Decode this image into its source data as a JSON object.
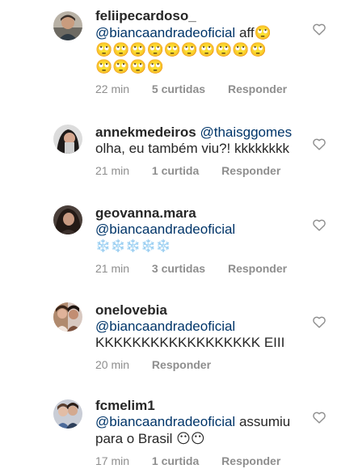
{
  "comments": [
    {
      "username": "feliipecardoso_",
      "mention": "@biancaandradeoficial",
      "text": " aff",
      "emoji_lines": [
        "🙄",
        "🙄🙄🙄🙄🙄🙄🙄🙄🙄🙄",
        "🙄🙄🙄🙄"
      ],
      "time": "22 min",
      "likes": "5 curtidas",
      "reply": "Responder",
      "like_icon": "heart-outline-icon"
    },
    {
      "username": "annekmedeiros",
      "mention": "@thaisggomes",
      "text_line2": "olha, eu também viu?! kkkkkkkk",
      "time": "21 min",
      "likes": "1 curtida",
      "reply": "Responder",
      "like_icon": "heart-outline-icon"
    },
    {
      "username": "geovanna.mara",
      "mention": "@biancaandradeoficial",
      "emoji_line": "❄️❄️❄️❄️❄️",
      "time": "21 min",
      "likes": "3 curtidas",
      "reply": "Responder",
      "like_icon": "heart-outline-icon"
    },
    {
      "username": "onelovebia",
      "mention": "@biancaandradeoficial",
      "text_line2": "KKKKKKKKKKKKKKKKKK EIII",
      "time": "20 min",
      "reply": "Responder",
      "like_icon": "heart-outline-icon"
    },
    {
      "username": "fcmelim1",
      "mention": "@biancaandradeoficial",
      "text": " assumiu",
      "text_line2": "para o Brasil ",
      "emoji": "😶😶",
      "time": "17 min",
      "likes": "1 curtida",
      "reply": "Responder",
      "like_icon": "heart-outline-icon"
    }
  ],
  "colors": {
    "text": "#262626",
    "mention": "#003569",
    "meta": "#8e8e8e",
    "background": "#ffffff"
  }
}
